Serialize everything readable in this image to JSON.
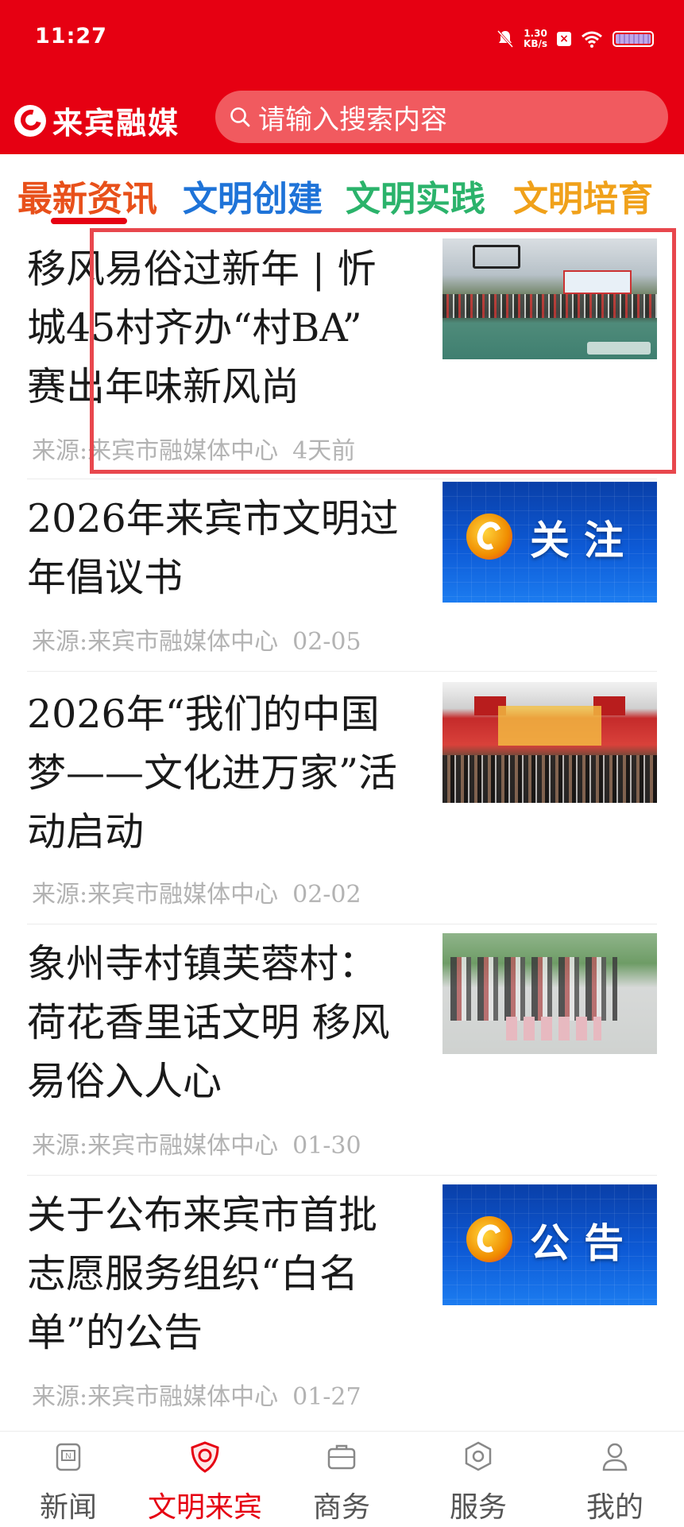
{
  "status_bar": {
    "time": "11:27",
    "net_speed": "1.30",
    "net_unit": "KB/s"
  },
  "header": {
    "app_name": "来宾融媒",
    "search_placeholder": "请输入搜索内容",
    "brand_color": "#e60012"
  },
  "tabs": [
    {
      "label": "最新资讯",
      "color": "#e8501a",
      "active": true
    },
    {
      "label": "文明创建",
      "color": "#1e73d8",
      "active": false
    },
    {
      "label": "文明实践",
      "color": "#2bb36b",
      "active": false
    },
    {
      "label": "文明培育",
      "color": "#f0a11a",
      "active": false
    }
  ],
  "news": [
    {
      "title": "移风易俗过新年 | 忻城45村齐办“村BA” 赛出年味新风尚",
      "source": "来源:来宾市融媒体中心",
      "date": "4天前",
      "thumb": "basketball-photo"
    },
    {
      "title": "2026年来宾市文明过年倡议书",
      "source": "来源:来宾市融媒体中心",
      "date": "02-05",
      "thumb": "blue-banner",
      "thumb_text": "关注"
    },
    {
      "title": "2026年“我们的中国梦——文化进万家”活动启动",
      "source": "来源:来宾市融媒体中心",
      "date": "02-02",
      "thumb": "festival-photo"
    },
    {
      "title": "象州寺村镇芙蓉村：荷花香里话文明 移风易俗入人心",
      "source": "来源:来宾市融媒体中心",
      "date": "01-30",
      "thumb": "village-photo"
    },
    {
      "title": "关于公布来宾市首批志愿服务组织“白名单”的公告",
      "source": "来源:来宾市融媒体中心",
      "date": "01-27",
      "thumb": "blue-banner",
      "thumb_text": "公告"
    }
  ],
  "bottom_nav": [
    {
      "label": "新闻",
      "icon": "news-icon",
      "active": false
    },
    {
      "label": "文明来宾",
      "icon": "shield-icon",
      "active": true
    },
    {
      "label": "商务",
      "icon": "briefcase-icon",
      "active": false
    },
    {
      "label": "服务",
      "icon": "hexagon-icon",
      "active": false
    },
    {
      "label": "我的",
      "icon": "user-icon",
      "active": false
    }
  ]
}
